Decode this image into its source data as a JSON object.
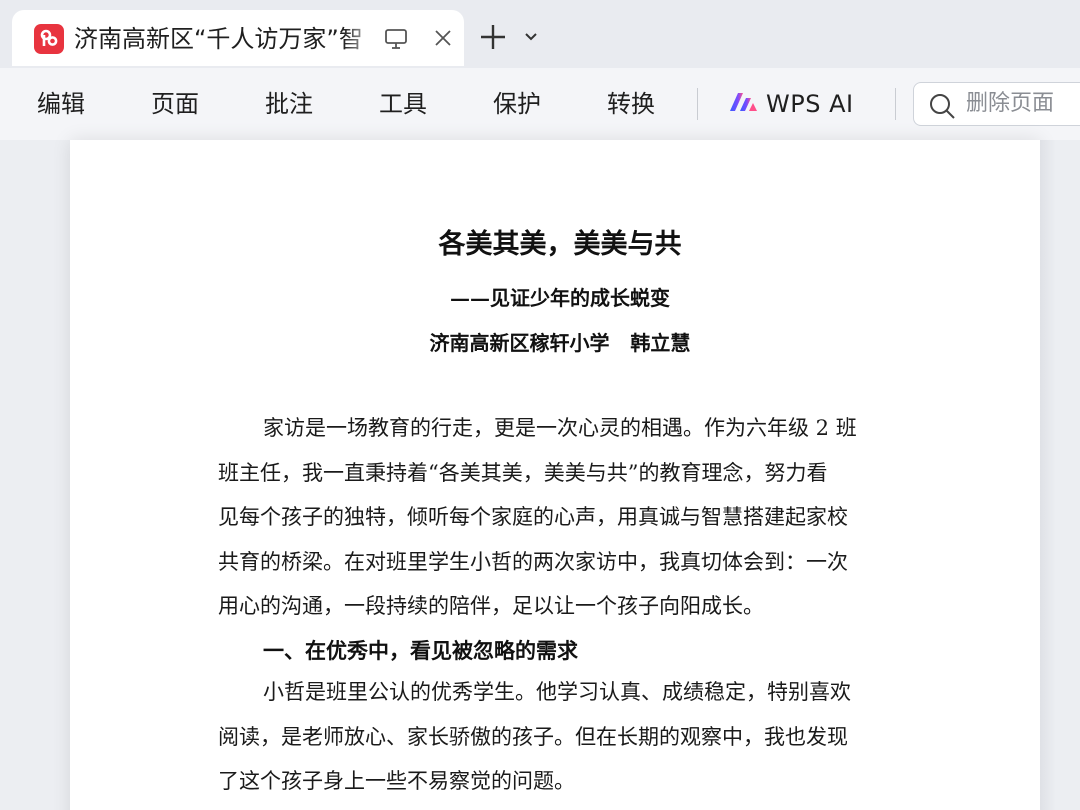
{
  "tab": {
    "title": "济南高新区“千人访万家”智",
    "logo_color": "#e8343f"
  },
  "ribbon": {
    "items": [
      "编辑",
      "页面",
      "批注",
      "工具",
      "保护",
      "转换"
    ],
    "ai_label": "WPS AI",
    "search_placeholder": "删除页面"
  },
  "document": {
    "title": "各美其美，美美与共",
    "subtitle": "——见证少年的成长蜕变",
    "author": "济南高新区稼轩小学   韩立慧",
    "para1_lines": [
      "家访是一场教育的行走，更是一次心灵的相遇。作为六年级 2 班",
      "班主任，我一直秉持着“各美其美，美美与共”的教育理念，努力看",
      "见每个孩子的独特，倾听每个家庭的心声，用真诚与智慧搭建起家校",
      "共育的桥梁。在对班里学生小哲的两次家访中，我真切体会到：一次",
      "用心的沟通，一段持续的陪伴，足以让一个孩子向阳成长。"
    ],
    "heading1": "一、在优秀中，看见被忽略的需求",
    "para2_lines": [
      "小哲是班里公认的优秀学生。他学习认真、成绩稳定，特别喜欢",
      "阅读，是老师放心、家长骄傲的孩子。但在长期的观察中，我也发现",
      "了这个孩子身上一些不易察觉的问题。"
    ]
  }
}
